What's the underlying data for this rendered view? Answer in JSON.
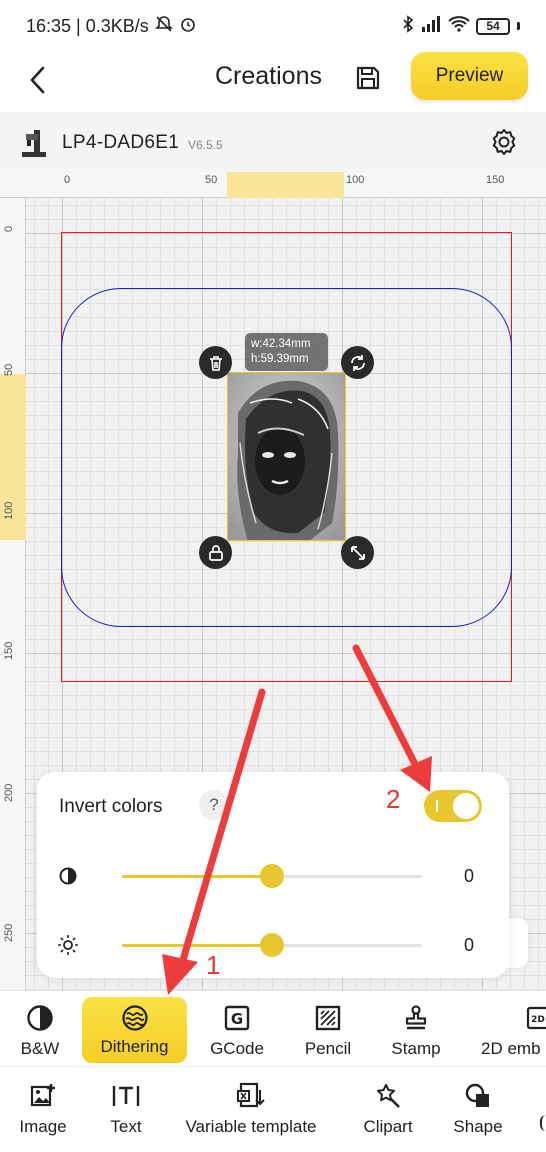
{
  "status_bar": {
    "time_speed": "16:35 | 0.3KB/s",
    "battery": "54"
  },
  "header": {
    "title": "Creations",
    "preview_label": "Preview"
  },
  "device": {
    "name": "LP4-DAD6E1",
    "version": "V6.5.5"
  },
  "canvas": {
    "ruler_top_ticks": [
      "0",
      "50",
      "100",
      "150"
    ],
    "ruler_left_ticks": [
      "0",
      "50",
      "100",
      "150",
      "200",
      "250"
    ],
    "size_label": {
      "width": "w:42.34mm",
      "height": "h:59.39mm"
    }
  },
  "annotations": {
    "arrow1": "1",
    "arrow2": "2"
  },
  "panel": {
    "invert_label": "Invert colors",
    "help_label": "?",
    "invert_on": true,
    "contrast": {
      "value": "0",
      "fraction": 0.5
    },
    "brightness": {
      "value": "0",
      "fraction": 0.5
    }
  },
  "toolbar_modes": [
    {
      "label": "B&W",
      "icon": "half-circle-icon"
    },
    {
      "label": "Dithering",
      "icon": "waves-icon"
    },
    {
      "label": "GCode",
      "icon": "gcode-icon"
    },
    {
      "label": "Pencil",
      "icon": "pencil-hatch-icon"
    },
    {
      "label": "Stamp",
      "icon": "stamp-icon"
    },
    {
      "label": "2D emb",
      "icon": "2d-icon"
    }
  ],
  "toolbar_insert": [
    {
      "label": "Image",
      "icon": "add-image-icon"
    },
    {
      "label": "Text",
      "icon": "text-icon"
    },
    {
      "label": "Variable template",
      "icon": "variable-template-icon"
    },
    {
      "label": "Clipart",
      "icon": "clipart-icon"
    },
    {
      "label": "Shape",
      "icon": "shape-icon"
    }
  ],
  "colors": {
    "accent": "#F5CD25",
    "work_area": "#E02020",
    "engrave_area": "#1B1BD0",
    "arrow": "#EE3B3B"
  }
}
